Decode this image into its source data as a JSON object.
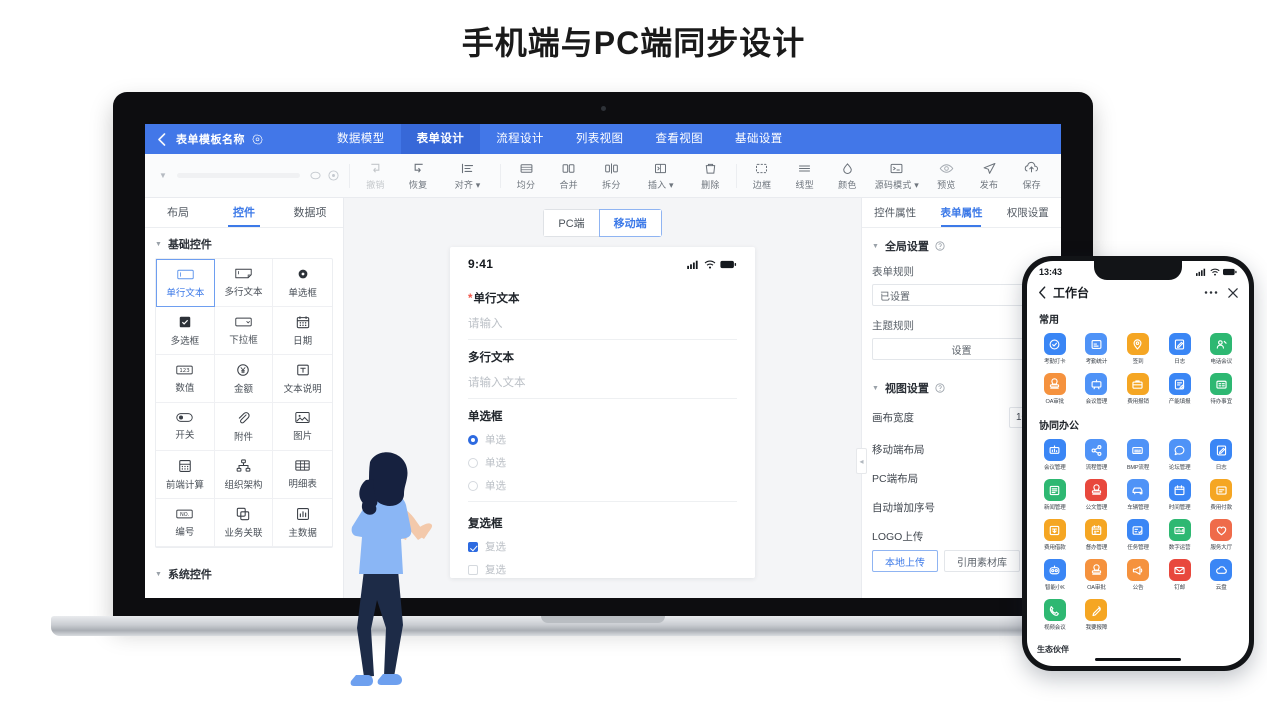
{
  "headline": "手机端与PC端同步设计",
  "laptop": {
    "appbar": {
      "back_icon": "chevron-left-icon",
      "template_name": "表单模板名称",
      "gear_icon": "gear-icon",
      "tabs": [
        {
          "label": "数据模型",
          "active": false
        },
        {
          "label": "表单设计",
          "active": true
        },
        {
          "label": "流程设计",
          "active": false
        },
        {
          "label": "列表视图",
          "active": false
        },
        {
          "label": "查看视图",
          "active": false
        },
        {
          "label": "基础设置",
          "active": false
        }
      ]
    },
    "toolbar": {
      "undo": "撤销",
      "redo": "恢复",
      "align": "对齐",
      "distribute": "均分",
      "merge": "合并",
      "split": "拆分",
      "insert": "插入",
      "delete": "删除",
      "border": "边框",
      "linetype": "线型",
      "color": "颜色",
      "sourcemode": "源码模式",
      "preview": "预览",
      "publish": "发布",
      "save": "保存"
    },
    "left_panel": {
      "tabs": [
        {
          "label": "布局",
          "active": false
        },
        {
          "label": "控件",
          "active": true
        },
        {
          "label": "数据项",
          "active": false
        }
      ],
      "group_basic": "基础控件",
      "group_system": "系统控件",
      "widgets": [
        {
          "label": "单行文本",
          "icon": "single-line-text-icon",
          "selected": true
        },
        {
          "label": "多行文本",
          "icon": "multi-line-text-icon",
          "selected": false
        },
        {
          "label": "单选框",
          "icon": "radio-icon",
          "selected": false
        },
        {
          "label": "多选框",
          "icon": "checkbox-icon",
          "selected": false
        },
        {
          "label": "下拉框",
          "icon": "dropdown-icon",
          "selected": false
        },
        {
          "label": "日期",
          "icon": "calendar-icon",
          "selected": false
        },
        {
          "label": "数值",
          "icon": "number-icon",
          "selected": false
        },
        {
          "label": "金额",
          "icon": "currency-icon",
          "selected": false
        },
        {
          "label": "文本说明",
          "icon": "text-note-icon",
          "selected": false
        },
        {
          "label": "开关",
          "icon": "toggle-icon",
          "selected": false
        },
        {
          "label": "附件",
          "icon": "paperclip-icon",
          "selected": false
        },
        {
          "label": "图片",
          "icon": "image-icon",
          "selected": false
        },
        {
          "label": "前端计算",
          "icon": "calculator-icon",
          "selected": false
        },
        {
          "label": "组织架构",
          "icon": "org-chart-icon",
          "selected": false
        },
        {
          "label": "明细表",
          "icon": "table-icon",
          "selected": false
        },
        {
          "label": "编号",
          "icon": "serial-number-icon",
          "selected": false
        },
        {
          "label": "业务关联",
          "icon": "link-copy-icon",
          "selected": false
        },
        {
          "label": "主数据",
          "icon": "bar-chart-icon",
          "selected": false
        }
      ]
    },
    "canvas": {
      "segments": [
        {
          "label": "PC端",
          "active": false
        },
        {
          "label": "移动端",
          "active": true
        }
      ],
      "status_time": "9:41",
      "fields": [
        {
          "label": "单行文本",
          "required": true,
          "placeholder": "请输入"
        },
        {
          "label": "多行文本",
          "required": false,
          "placeholder": "请输入文本"
        }
      ],
      "radio_group": {
        "label": "单选框",
        "options": [
          "单选",
          "单选",
          "单选"
        ],
        "checked_index": 0
      },
      "checkbox_group": {
        "label": "复选框",
        "options": [
          "复选",
          "复选",
          "复选"
        ],
        "checked_index": 0
      }
    },
    "right_panel": {
      "tabs": [
        {
          "label": "控件属性",
          "active": false
        },
        {
          "label": "表单属性",
          "active": true
        },
        {
          "label": "权限设置",
          "active": false
        }
      ],
      "section_global": "全局设置",
      "form_rule_label": "表单规则",
      "form_rule_value": "已设置",
      "theme_rule_label": "主题规则",
      "theme_rule_button": "设置",
      "section_view": "视图设置",
      "canvas_width_label": "画布宽度",
      "canvas_width_value": "100",
      "mobile_layout_label": "移动端布局",
      "pc_layout_label": "PC端布局",
      "auto_serial_label": "自动增加序号",
      "logo_upload_label": "LOGO上传",
      "upload_local": "本地上传",
      "upload_material": "引用素材库"
    }
  },
  "phone": {
    "status_time": "13:43",
    "nav_back_icon": "chevron-left-icon",
    "title": "工作台",
    "more_icon": "more-dots-icon",
    "close_icon": "close-icon",
    "footer_text": "生态伙伴",
    "sections": [
      {
        "title": "常用",
        "apps": [
          {
            "label": "考勤打卡",
            "color": "#3a86f5",
            "icon": "clock-check-icon"
          },
          {
            "label": "考勤统计",
            "color": "#4f93f7",
            "icon": "report-icon"
          },
          {
            "label": "签到",
            "color": "#f5a623",
            "icon": "location-pin-icon"
          },
          {
            "label": "日志",
            "color": "#3a86f5",
            "icon": "edit-doc-icon"
          },
          {
            "label": "电话会议",
            "color": "#2eb872",
            "icon": "person-phone-icon"
          },
          {
            "label": "OA审批",
            "color": "#f5923e",
            "icon": "stamp-icon"
          },
          {
            "label": "会议管理",
            "color": "#4f93f7",
            "icon": "projector-icon"
          },
          {
            "label": "费用报销",
            "color": "#f5a623",
            "icon": "briefcase-icon"
          },
          {
            "label": "产能填报",
            "color": "#3a86f5",
            "icon": "form-edit-icon"
          },
          {
            "label": "待办事宜",
            "color": "#2eb872",
            "icon": "todo-list-icon"
          }
        ]
      },
      {
        "title": "协同办公",
        "apps": [
          {
            "label": "会议管理",
            "color": "#3a86f5",
            "icon": "meeting-icon"
          },
          {
            "label": "流程管理",
            "color": "#4f93f7",
            "icon": "share-nodes-icon"
          },
          {
            "label": "BMP流程",
            "color": "#4f93f7",
            "icon": "bmp-flow-icon"
          },
          {
            "label": "论坛管理",
            "color": "#4f93f7",
            "icon": "chat-bubble-icon"
          },
          {
            "label": "日志",
            "color": "#3a86f5",
            "icon": "edit-doc-icon"
          },
          {
            "label": "新闻管理",
            "color": "#2eb872",
            "icon": "news-icon"
          },
          {
            "label": "公文管理",
            "color": "#e8483d",
            "icon": "stamp-icon"
          },
          {
            "label": "车辆管理",
            "color": "#4f93f7",
            "icon": "car-icon"
          },
          {
            "label": "时间管理",
            "color": "#3a86f5",
            "icon": "calendar-icon"
          },
          {
            "label": "费用付款",
            "color": "#f5a623",
            "icon": "payment-icon"
          },
          {
            "label": "费用借款",
            "color": "#f5a623",
            "icon": "loan-icon"
          },
          {
            "label": "督办管理",
            "color": "#f5a623",
            "icon": "supervise-icon"
          },
          {
            "label": "任务管理",
            "color": "#3a86f5",
            "icon": "task-icon"
          },
          {
            "label": "数字运营",
            "color": "#2eb872",
            "icon": "dashboard-icon"
          },
          {
            "label": "服务大厅",
            "color": "#ef6b4a",
            "icon": "service-hall-icon"
          },
          {
            "label": "智能小K",
            "color": "#3a86f5",
            "icon": "robot-icon"
          },
          {
            "label": "OA审批",
            "color": "#f5923e",
            "icon": "stamp-icon"
          },
          {
            "label": "公告",
            "color": "#f5923e",
            "icon": "megaphone-icon"
          },
          {
            "label": "钉邮",
            "color": "#e8483d",
            "icon": "mail-icon"
          },
          {
            "label": "云盘",
            "color": "#3a86f5",
            "icon": "cloud-icon"
          },
          {
            "label": "视频会议",
            "color": "#2eb872",
            "icon": "video-call-icon"
          },
          {
            "label": "我要报障",
            "color": "#f5a623",
            "icon": "pencil-icon"
          }
        ]
      }
    ]
  }
}
